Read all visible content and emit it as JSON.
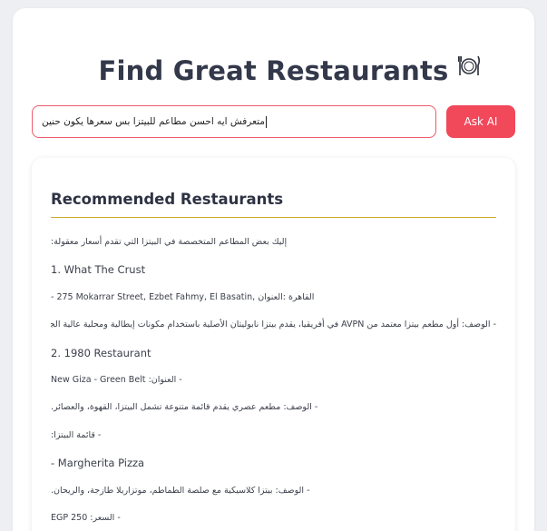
{
  "header": {
    "title": "Find Great Restaurants",
    "icon": "plate-cutlery-icon"
  },
  "search": {
    "value": "متعرفش ايه احسن مطاعم للبيتزا بس سعرها يكون حنين",
    "button_label": "Ask AI"
  },
  "colors": {
    "accent": "#f1485a",
    "input_border": "#ee5b6a",
    "divider": "#c9a82a",
    "background": "#eeeff3"
  },
  "results": {
    "title": "Recommended Restaurants",
    "lines": [
      "إليك بعض المطاعم المتخصصة في البيتزا التي تقدم أسعار معقولة:",
      "1. What The Crust",
      "- 275 Mokarrar Street, Ezbet Fahmy, El Basatin, القاهرة :العنوان",
      "- الوصف: أول مطعم بيتزا معتمد من AVPN في أفريقيا، يقدم بيتزا نابوليتان الأصلية باستخدام مكونات إيطالية ومحلية عالية الجودة.",
      "2. 1980 Restaurant",
      "- العنوان: New Giza - Green Belt",
      "- الوصف: مطعم عصري يقدم قائمة متنوعة تشمل البيتزا، القهوة، والعصائر.",
      "- قائمة البيتزا:",
      "- Margherita Pizza",
      "- الوصف: بيتزا كلاسيكية مع صلصة الطماطم، موتزاريلا طازجة، والريحان.",
      "- السعر: 250 EGP"
    ]
  }
}
